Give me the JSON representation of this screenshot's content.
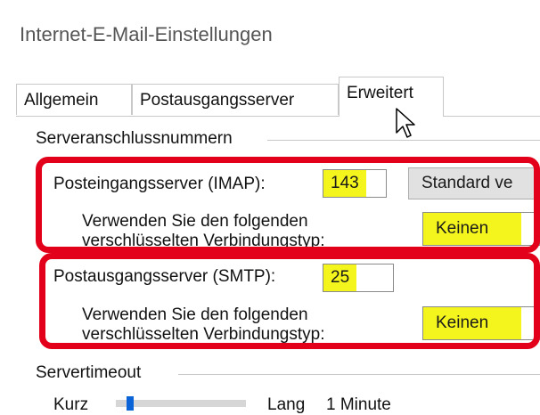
{
  "window": {
    "title": "Internet-E-Mail-Einstellungen"
  },
  "tabs": [
    {
      "label": "Allgemein",
      "active": false
    },
    {
      "label": "Postausgangsserver",
      "active": false
    },
    {
      "label": "Erweitert",
      "active": true
    }
  ],
  "ports_group": {
    "label": "Serveranschlussnummern",
    "incoming": {
      "label": "Posteingangsserver (IMAP):",
      "value": "143",
      "default_button": "Standard ve",
      "encryption_label_1": "Verwenden Sie den folgenden",
      "encryption_label_2": "verschlüsselten Verbindungstyp:",
      "encryption_value": "Keinen"
    },
    "outgoing": {
      "label": "Postausgangsserver (SMTP):",
      "value": "25",
      "encryption_label_1": "Verwenden Sie den folgenden",
      "encryption_label_2": "verschlüsselten Verbindungstyp:",
      "encryption_value": "Keinen"
    }
  },
  "timeout_group": {
    "label": "Servertimeout",
    "short_label": "Kurz",
    "long_label": "Lang",
    "value_label": "1 Minute"
  },
  "colors": {
    "highlight": "#f5f51e",
    "annotation_red": "#e2001a"
  }
}
